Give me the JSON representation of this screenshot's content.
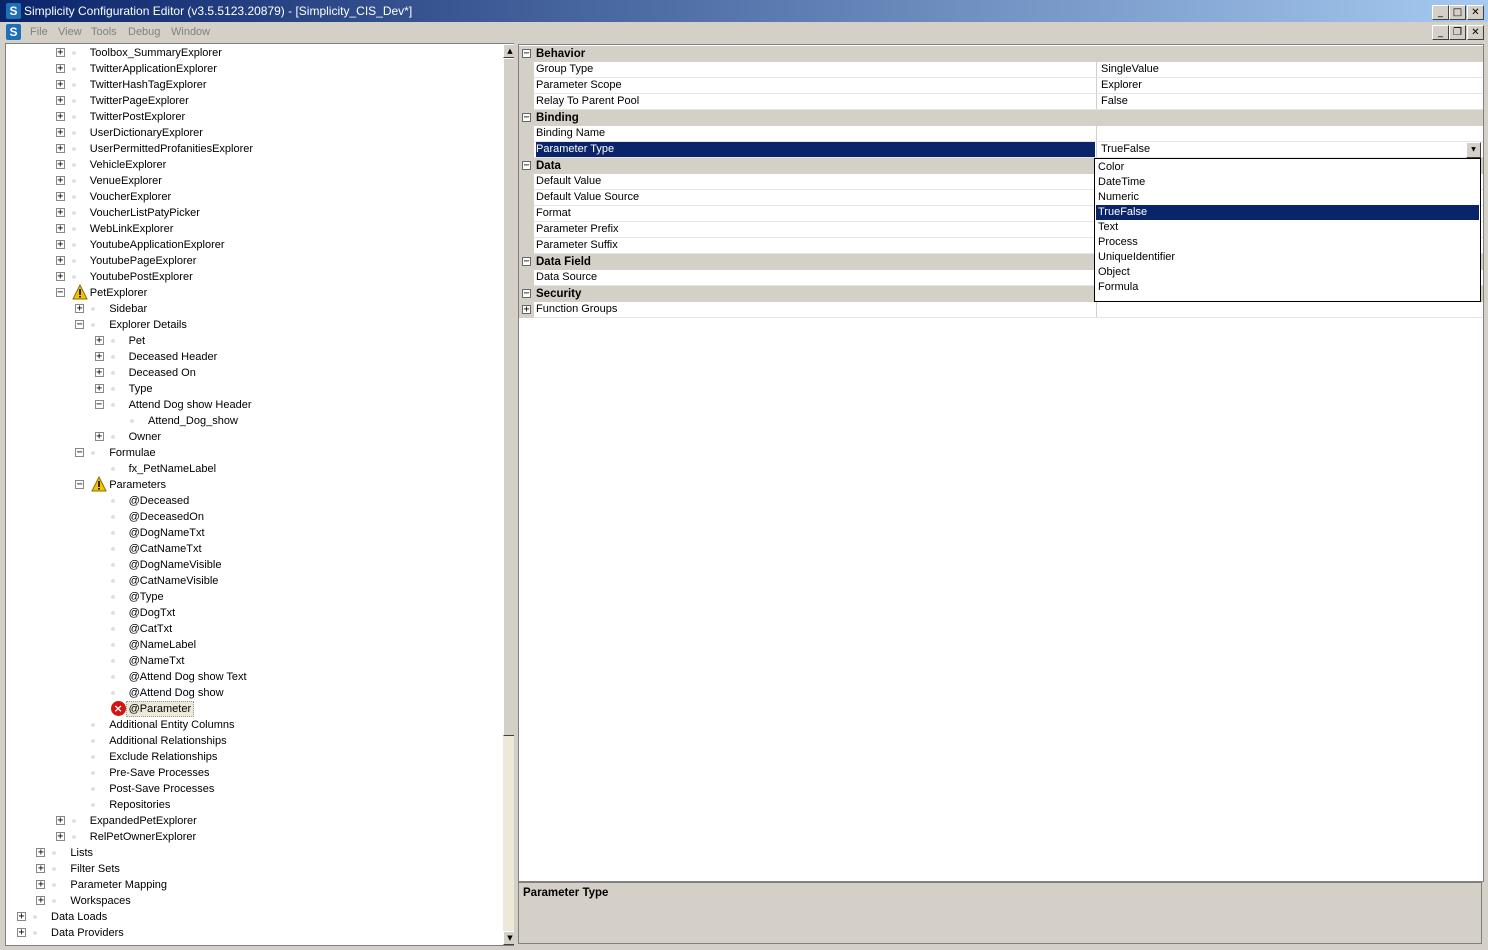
{
  "window": {
    "title": "Simplicity Configuration Editor (v3.5.5123.20879) - [Simplicity_CIS_Dev*]",
    "icon": "S",
    "buttons": {
      "minimize": "_",
      "maximize": "□",
      "close": "✕",
      "restore": "❐"
    }
  },
  "menu": {
    "items": [
      "File",
      "View",
      "Tools",
      "Debug",
      "Window"
    ]
  },
  "tree": {
    "rows": [
      {
        "label": "Toolbox_SummaryExplorer",
        "level": 3,
        "expander": "+",
        "icon": "dot"
      },
      {
        "label": "TwitterApplicationExplorer",
        "level": 3,
        "expander": "+",
        "icon": "dot"
      },
      {
        "label": "TwitterHashTagExplorer",
        "level": 3,
        "expander": "+",
        "icon": "dot"
      },
      {
        "label": "TwitterPageExplorer",
        "level": 3,
        "expander": "+",
        "icon": "dot"
      },
      {
        "label": "TwitterPostExplorer",
        "level": 3,
        "expander": "+",
        "icon": "dot"
      },
      {
        "label": "UserDictionaryExplorer",
        "level": 3,
        "expander": "+",
        "icon": "dot"
      },
      {
        "label": "UserPermittedProfanitiesExplorer",
        "level": 3,
        "expander": "+",
        "icon": "dot"
      },
      {
        "label": "VehicleExplorer",
        "level": 3,
        "expander": "+",
        "icon": "dot"
      },
      {
        "label": "VenueExplorer",
        "level": 3,
        "expander": "+",
        "icon": "dot"
      },
      {
        "label": "VoucherExplorer",
        "level": 3,
        "expander": "+",
        "icon": "dot"
      },
      {
        "label": "VoucherListPatyPicker",
        "level": 3,
        "expander": "+",
        "icon": "dot"
      },
      {
        "label": "WebLinkExplorer",
        "level": 3,
        "expander": "+",
        "icon": "dot"
      },
      {
        "label": "YoutubeApplicationExplorer",
        "level": 3,
        "expander": "+",
        "icon": "dot"
      },
      {
        "label": "YoutubePageExplorer",
        "level": 3,
        "expander": "+",
        "icon": "dot"
      },
      {
        "label": "YoutubePostExplorer",
        "level": 3,
        "expander": "+",
        "icon": "dot"
      },
      {
        "label": "PetExplorer",
        "level": 3,
        "expander": "−",
        "icon": "warning"
      },
      {
        "label": "Sidebar",
        "level": 4,
        "expander": "+",
        "icon": "dot"
      },
      {
        "label": "Explorer Details",
        "level": 4,
        "expander": "−",
        "icon": "dot"
      },
      {
        "label": "Pet",
        "level": 5,
        "expander": "+",
        "icon": "dot"
      },
      {
        "label": "Deceased Header",
        "level": 5,
        "expander": "+",
        "icon": "dot"
      },
      {
        "label": "Deceased On",
        "level": 5,
        "expander": "+",
        "icon": "dot"
      },
      {
        "label": "Type",
        "level": 5,
        "expander": "+",
        "icon": "dot"
      },
      {
        "label": "Attend Dog show Header",
        "level": 5,
        "expander": "−",
        "icon": "dot"
      },
      {
        "label": "Attend_Dog_show",
        "level": 6,
        "expander": "",
        "icon": "dot"
      },
      {
        "label": "Owner",
        "level": 5,
        "expander": "+",
        "icon": "dot"
      },
      {
        "label": "Formulae",
        "level": 4,
        "expander": "−",
        "icon": "dot"
      },
      {
        "label": "fx_PetNameLabel",
        "level": 5,
        "expander": "",
        "icon": "dot"
      },
      {
        "label": "Parameters",
        "level": 4,
        "expander": "−",
        "icon": "warning"
      },
      {
        "label": "@Deceased",
        "level": 5,
        "expander": "",
        "icon": "dot"
      },
      {
        "label": "@DeceasedOn",
        "level": 5,
        "expander": "",
        "icon": "dot"
      },
      {
        "label": "@DogNameTxt",
        "level": 5,
        "expander": "",
        "icon": "dot"
      },
      {
        "label": "@CatNameTxt",
        "level": 5,
        "expander": "",
        "icon": "dot"
      },
      {
        "label": "@DogNameVisible",
        "level": 5,
        "expander": "",
        "icon": "dot"
      },
      {
        "label": "@CatNameVisible",
        "level": 5,
        "expander": "",
        "icon": "dot"
      },
      {
        "label": "@Type",
        "level": 5,
        "expander": "",
        "icon": "dot"
      },
      {
        "label": "@DogTxt",
        "level": 5,
        "expander": "",
        "icon": "dot"
      },
      {
        "label": "@CatTxt",
        "level": 5,
        "expander": "",
        "icon": "dot"
      },
      {
        "label": "@NameLabel",
        "level": 5,
        "expander": "",
        "icon": "dot"
      },
      {
        "label": "@NameTxt",
        "level": 5,
        "expander": "",
        "icon": "dot"
      },
      {
        "label": "@Attend Dog show Text",
        "level": 5,
        "expander": "",
        "icon": "dot"
      },
      {
        "label": "@Attend Dog show",
        "level": 5,
        "expander": "",
        "icon": "dot"
      },
      {
        "label": "@Parameter",
        "level": 5,
        "expander": "",
        "icon": "error",
        "selected": true
      },
      {
        "label": "Additional Entity Columns",
        "level": 4,
        "expander": "",
        "icon": "dot"
      },
      {
        "label": "Additional Relationships",
        "level": 4,
        "expander": "",
        "icon": "dot"
      },
      {
        "label": "Exclude Relationships",
        "level": 4,
        "expander": "",
        "icon": "dot"
      },
      {
        "label": "Pre-Save Processes",
        "level": 4,
        "expander": "",
        "icon": "dot"
      },
      {
        "label": "Post-Save Processes",
        "level": 4,
        "expander": "",
        "icon": "dot"
      },
      {
        "label": "Repositories",
        "level": 4,
        "expander": "",
        "icon": "dot"
      },
      {
        "label": "ExpandedPetExplorer",
        "level": 3,
        "expander": "+",
        "icon": "dot"
      },
      {
        "label": "RelPetOwnerExplorer",
        "level": 3,
        "expander": "+",
        "icon": "dot"
      },
      {
        "label": "Lists",
        "level": 2,
        "expander": "+",
        "icon": "dot"
      },
      {
        "label": "Filter Sets",
        "level": 2,
        "expander": "+",
        "icon": "dot"
      },
      {
        "label": "Parameter Mapping",
        "level": 2,
        "expander": "+",
        "icon": "dot"
      },
      {
        "label": "Workspaces",
        "level": 2,
        "expander": "+",
        "icon": "dot"
      },
      {
        "label": "Data Loads",
        "level": 1,
        "expander": "+",
        "icon": "dot"
      },
      {
        "label": "Data Providers",
        "level": 1,
        "expander": "+",
        "icon": "dot"
      }
    ]
  },
  "properties": {
    "rows": [
      {
        "kind": "category",
        "label": "Behavior",
        "expander": "−"
      },
      {
        "kind": "prop",
        "name": "Group Type",
        "value": "SingleValue"
      },
      {
        "kind": "prop",
        "name": "Parameter Scope",
        "value": "Explorer"
      },
      {
        "kind": "prop",
        "name": "Relay To Parent Pool",
        "value": "False"
      },
      {
        "kind": "category",
        "label": "Binding",
        "expander": "−"
      },
      {
        "kind": "prop",
        "name": "Binding Name",
        "value": ""
      },
      {
        "kind": "prop",
        "name": "Parameter Type",
        "value": "TrueFalse",
        "selected": true,
        "dropdown": true
      },
      {
        "kind": "category",
        "label": "Data",
        "expander": "−"
      },
      {
        "kind": "prop",
        "name": "Default Value",
        "value": ""
      },
      {
        "kind": "prop",
        "name": "Default Value Source",
        "value": ""
      },
      {
        "kind": "prop",
        "name": "Format",
        "value": ""
      },
      {
        "kind": "prop",
        "name": "Parameter Prefix",
        "value": ""
      },
      {
        "kind": "prop",
        "name": "Parameter Suffix",
        "value": ""
      },
      {
        "kind": "category",
        "label": "Data Field",
        "expander": "−"
      },
      {
        "kind": "prop",
        "name": "Data Source",
        "value": ""
      },
      {
        "kind": "category",
        "label": "Security",
        "expander": "−"
      },
      {
        "kind": "prop",
        "name": "Function Groups",
        "value": "",
        "expander": "+"
      }
    ],
    "dropdown_arrow": "▼"
  },
  "dropdown": {
    "options": [
      "Color",
      "DateTime",
      "Numeric",
      "TrueFalse",
      "Text",
      "Process",
      "UniqueIdentifier",
      "Object",
      "Formula"
    ],
    "selected": "TrueFalse"
  },
  "help": {
    "title": "Parameter Type"
  },
  "scrollbar": {
    "up": "▲",
    "down": "▼"
  },
  "colors": {
    "selection": "#0a246a",
    "titlebar_start": "#0a246a",
    "titlebar_end": "#a6caf0",
    "chrome": "#d4d0c8"
  }
}
